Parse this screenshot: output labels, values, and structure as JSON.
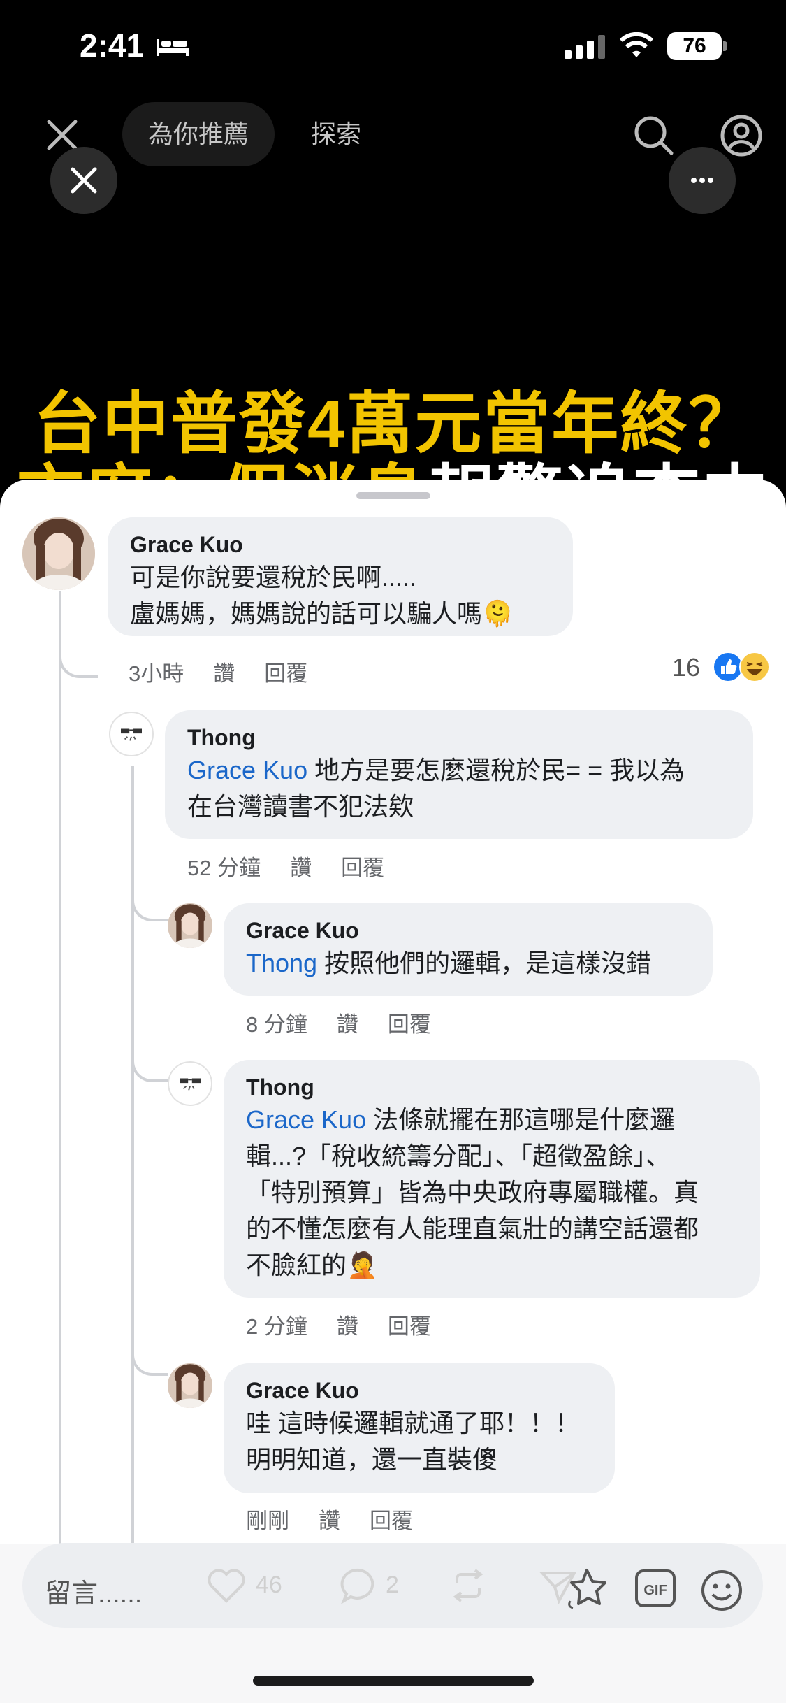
{
  "status": {
    "time": "2:41",
    "battery": "76"
  },
  "nav": {
    "tab_recommended": "為你推薦",
    "tab_explore": "探索"
  },
  "headline": {
    "line1": "台中普發4萬元當年終？",
    "line2_yellow": "市府：假消息",
    "line2_white": "報警追查中"
  },
  "comments": [
    {
      "author": "Grace Kuo",
      "lines": [
        "可是你說要還稅於民啊.....",
        "盧媽媽，媽媽說的話可以騙人嗎"
      ],
      "emoji": "🫠",
      "time": "3小時",
      "like": "讚",
      "reply": "回覆",
      "reaction_count": "16"
    },
    {
      "author": "Thong",
      "mention": "Grace Kuo",
      "text_after_mention": " 地方是要怎麼還稅於民= = 我以為",
      "line2": "在台灣讀書不犯法欸",
      "time": "52 分鐘",
      "like": "讚",
      "reply": "回覆"
    },
    {
      "author": "Grace Kuo",
      "mention": "Thong",
      "text_after_mention": " 按照他們的邏輯，是這樣沒錯",
      "time": "8 分鐘",
      "like": "讚",
      "reply": "回覆"
    },
    {
      "author": "Thong",
      "mention": "Grace Kuo",
      "text_after_mention": " 法條就擺在那這哪是什麼邏",
      "line2": "輯...?「稅收統籌分配」、「超徵盈餘」、",
      "line3": "「特別預算」皆為中央政府專屬職權。真",
      "line4": "的不懂怎麼有人能理直氣壯的講空話還都",
      "line5": "不臉紅的",
      "emoji": "🤦",
      "time": "2 分鐘",
      "like": "讚",
      "reply": "回覆"
    },
    {
      "author": "Grace Kuo",
      "lines": [
        "哇 這時候邏輯就通了耶！！！",
        "明明知道，還一直裝傻"
      ],
      "time": "剛剛",
      "like": "讚",
      "reply": "回覆"
    }
  ],
  "bottom_bar": {
    "placeholder": "留言......",
    "likes": "46",
    "comments": "2",
    "gif_label": "GIF"
  },
  "colors": {
    "mention": "#1b67c9",
    "headline_yellow": "#f2c400",
    "bubble": "#eef0f3",
    "like_blue": "#1877f2"
  },
  "icons": [
    "close-icon",
    "search-icon",
    "profile-icon",
    "more-icon",
    "like-icon",
    "haha-icon",
    "heart-icon",
    "comment-icon",
    "repost-icon",
    "share-icon",
    "sticker-icon",
    "gif-icon",
    "emoji-icon"
  ]
}
